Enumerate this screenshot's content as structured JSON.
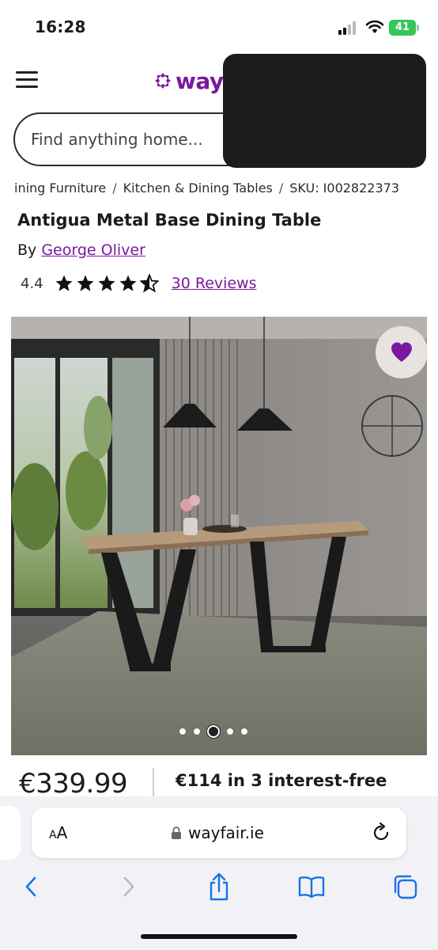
{
  "status_bar": {
    "time": "16:28",
    "battery": "41"
  },
  "header": {
    "logo_text": "way"
  },
  "search": {
    "placeholder": "Find anything home..."
  },
  "breadcrumbs": [
    "ining Furniture",
    "Kitchen & Dining Tables",
    "SKU: I002822373"
  ],
  "product": {
    "title": "Antigua Metal Base Dining Table",
    "by_prefix": "By",
    "brand": "George Oliver",
    "rating": "4.4",
    "reviews": "30 Reviews",
    "image_count": 5,
    "active_image": 3,
    "price": "€339.99",
    "installments": "€114 in 3 interest-free"
  },
  "browser": {
    "text_size_label": "AA",
    "domain": "wayfair.ie"
  },
  "colors": {
    "brand_purple": "#7b189f",
    "battery_green": "#34c759"
  },
  "icons": [
    "menu-icon",
    "wayfair-logo-icon",
    "star-icon",
    "half-star-icon",
    "heart-icon",
    "lock-icon",
    "reload-icon",
    "back-icon",
    "forward-icon",
    "share-icon",
    "bookmarks-icon",
    "tabs-icon"
  ]
}
